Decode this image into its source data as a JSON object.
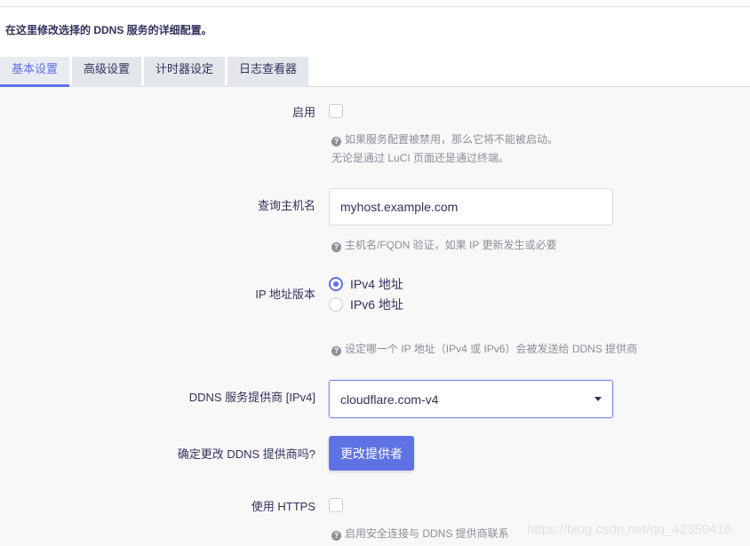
{
  "page": {
    "description": "在这里修改选择的 DDNS 服务的详细配置。"
  },
  "tabs": [
    {
      "label": "基本设置",
      "active": true
    },
    {
      "label": "高级设置",
      "active": false
    },
    {
      "label": "计时器设定",
      "active": false
    },
    {
      "label": "日志查看器",
      "active": false
    }
  ],
  "form": {
    "enable": {
      "label": "启用",
      "checked": false,
      "help_line1": "如果服务配置被禁用，那么它将不能被启动。",
      "help_line2": "无论是通过 LuCI 页面还是通过终端。"
    },
    "lookup_host": {
      "label": "查询主机名",
      "value": "myhost.example.com",
      "help": "主机名/FQDN 验证，如果 IP 更新发生或必要"
    },
    "ip_version": {
      "label": "IP 地址版本",
      "options": [
        "IPv4 地址",
        "IPv6 地址"
      ],
      "selected": "IPv4 地址",
      "help": "设定哪一个 IP 地址（IPv4 或 IPv6）会被发送给 DDNS 提供商"
    },
    "provider": {
      "label": "DDNS 服务提供商 [IPv4]",
      "value": "cloudflare.com-v4"
    },
    "change_provider": {
      "label": "确定更改 DDNS 提供商吗?",
      "button": "更改提供者"
    },
    "https": {
      "label": "使用 HTTPS",
      "checked": false,
      "help": "启用安全连接与 DDNS 提供商联系"
    }
  },
  "watermark": "https://blog.csdn.net/qq_42359416",
  "colors": {
    "accent": "#5e72e4",
    "text": "#32325d",
    "help": "#8a8f98",
    "background": "#f8f8f8"
  }
}
